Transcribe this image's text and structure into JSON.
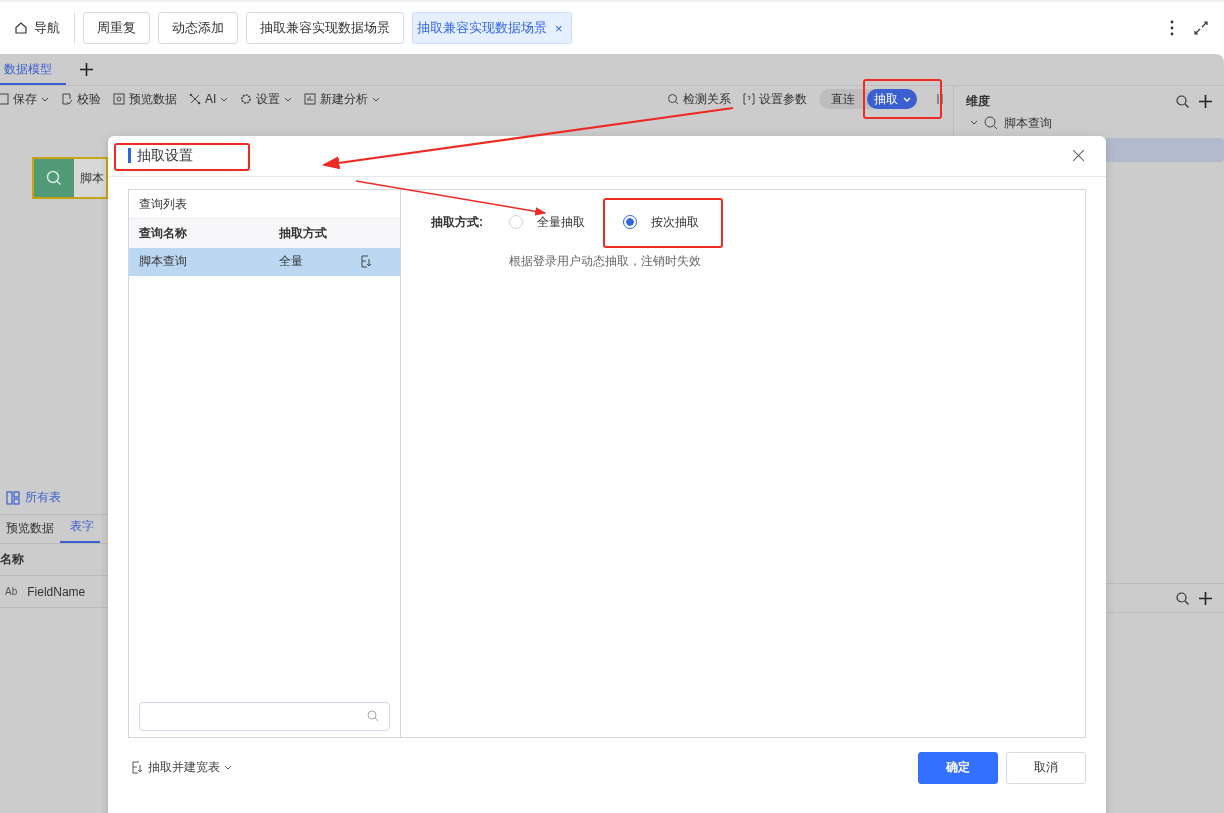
{
  "nav": {
    "label": "导航"
  },
  "tabs": [
    {
      "label": "周重复",
      "selected": false,
      "closable": false
    },
    {
      "label": "动态添加",
      "selected": false,
      "closable": false
    },
    {
      "label": "抽取兼容实现数据场景",
      "selected": false,
      "closable": false
    },
    {
      "label": "抽取兼容实现数据场景",
      "selected": true,
      "closable": true
    }
  ],
  "close_tab_glyph": "×",
  "model_tabs": [
    {
      "label": "数据模型",
      "selected": true
    }
  ],
  "toolbar": [
    {
      "label": "保存",
      "kind": "save",
      "dropdown": true
    },
    {
      "label": "校验",
      "kind": "check",
      "dropdown": false
    },
    {
      "label": "预览数据",
      "kind": "preview",
      "dropdown": false
    },
    {
      "label": "AI",
      "kind": "ai",
      "dropdown": true
    },
    {
      "label": "设置",
      "kind": "gear",
      "dropdown": true
    },
    {
      "label": "新建分析",
      "kind": "analysis",
      "dropdown": true
    }
  ],
  "toolbar_right": [
    {
      "label": "检测关系",
      "kind": "detect"
    },
    {
      "label": "设置参数",
      "kind": "param"
    }
  ],
  "mode_switch": [
    {
      "label": "直连",
      "selected": false
    },
    {
      "label": "抽取",
      "selected": true
    }
  ],
  "dimension_panel": {
    "title": "维度",
    "tree": [
      {
        "label": "脚本查询",
        "expanded": true
      }
    ]
  },
  "canvas_node": {
    "label": "脚本"
  },
  "all_tables": {
    "label": "所有表"
  },
  "bottom_tabs": [
    {
      "label": "预览数据",
      "selected": false
    },
    {
      "label": "表字",
      "selected": true
    }
  ],
  "field_table": {
    "column": "名称",
    "rows": [
      {
        "type_label": "Ab",
        "name": "FieldName"
      }
    ]
  },
  "dialog": {
    "title": "抽取设置",
    "query_list": {
      "title": "查询列表",
      "columns": [
        "查询名称",
        "抽取方式"
      ],
      "rows": [
        {
          "name": "脚本查询",
          "mode": "全量",
          "selected": true
        }
      ]
    },
    "extract_label": "抽取方式:",
    "options": [
      {
        "label": "全量抽取",
        "selected": false
      },
      {
        "label": "按次抽取",
        "selected": true
      }
    ],
    "hint": "根据登录用户动态抽取，注销时失效",
    "footer_link": "抽取并建宽表",
    "buttons": [
      {
        "label": "确定",
        "kind": "primary"
      },
      {
        "label": "取消",
        "kind": "default"
      }
    ]
  }
}
